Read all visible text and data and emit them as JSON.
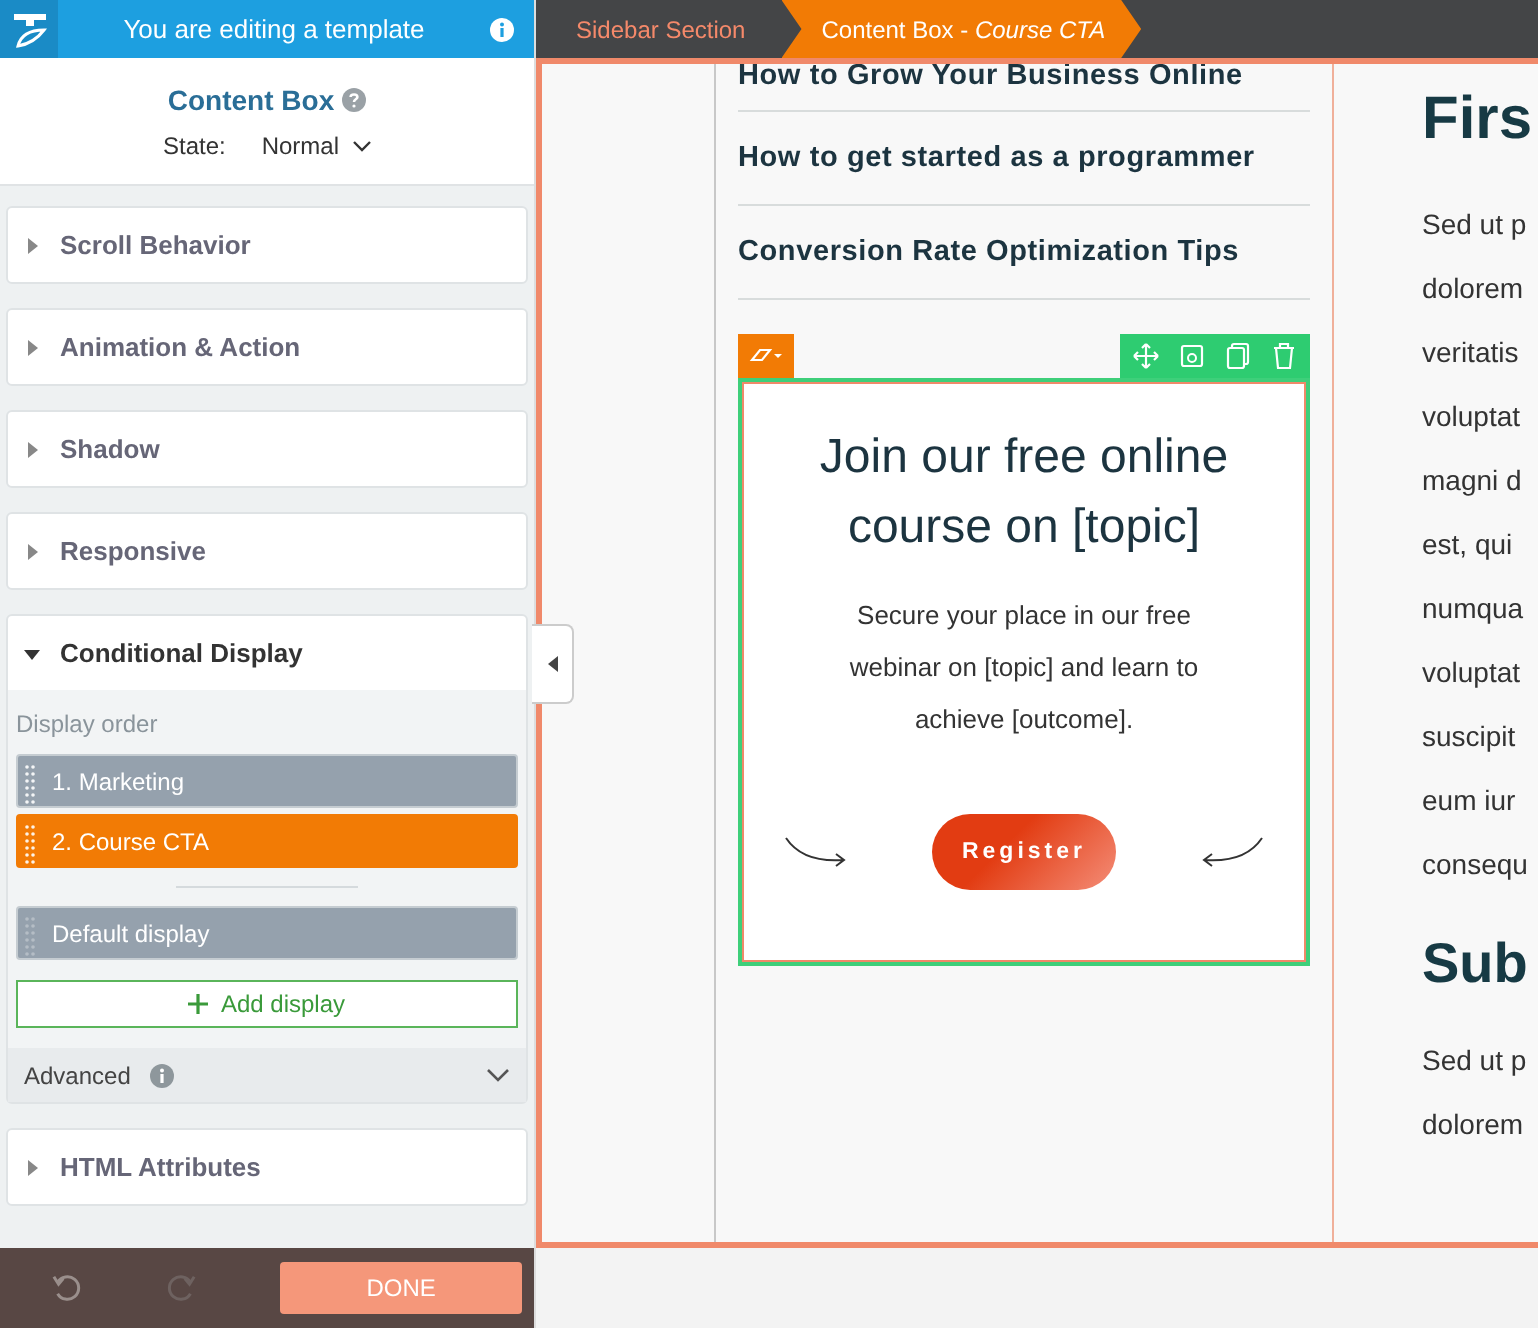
{
  "header": {
    "title": "You are editing a template"
  },
  "panel": {
    "title": "Content Box",
    "state_label": "State:",
    "state_value": "Normal"
  },
  "sections": [
    {
      "label": "Scroll Behavior",
      "expanded": false
    },
    {
      "label": "Animation & Action",
      "expanded": false
    },
    {
      "label": "Shadow",
      "expanded": false
    },
    {
      "label": "Responsive",
      "expanded": false
    },
    {
      "label": "Conditional Display",
      "expanded": true
    },
    {
      "label": "HTML Attributes",
      "expanded": false
    }
  ],
  "conditional": {
    "order_label": "Display order",
    "displays": [
      {
        "label": "1. Marketing",
        "selected": false,
        "kind": "condition"
      },
      {
        "label": "2. Course CTA",
        "selected": true,
        "kind": "condition"
      },
      {
        "label": "Default display",
        "selected": false,
        "kind": "default"
      }
    ],
    "add_label": "Add display",
    "advanced_label": "Advanced"
  },
  "footer": {
    "done": "DONE"
  },
  "breadcrumbs": [
    {
      "label": "Sidebar Section",
      "selected": false
    },
    {
      "label": "Content Box - *Course CTA*",
      "selected": true
    }
  ],
  "sidebar_links": [
    "How to Grow Your Business Online",
    "How to get started as a programmer",
    "Conversion Rate Optimization Tips"
  ],
  "cta": {
    "title": "Join our free online course on [topic]",
    "text": "Secure your place in our free webinar on [topic] and learn to achieve [outcome].",
    "button": "Register"
  },
  "article": {
    "heading": "Firs",
    "paragraph": [
      "Sed ut p",
      "dolorem",
      "veritatis",
      "voluptat",
      "magni d",
      "est, qui",
      "numqua",
      "voluptat",
      "suscipit",
      "eum iur",
      "consequ"
    ],
    "subheading": "Sub",
    "paragraph_2": [
      "Sed ut p",
      "dolorem"
    ]
  }
}
